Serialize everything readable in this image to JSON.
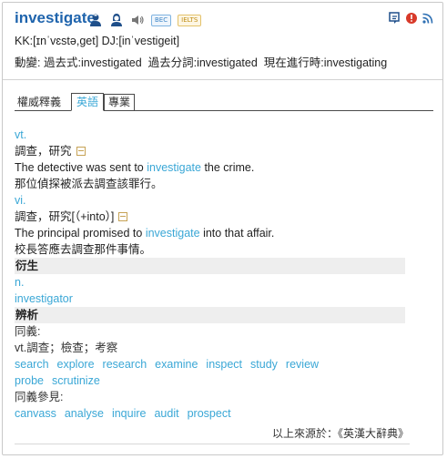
{
  "header": {
    "word": "investigate",
    "badges": {
      "bec": "BEC",
      "ielts": "IELTS"
    },
    "pronunciation": "KK:[ɪnˈvɛstə,get] DJ:[inˈvestigeit]",
    "forms": {
      "label": "動變:",
      "past": "過去式:investigated",
      "past_participle": "過去分詞:investigated",
      "present_participle": "現在進行時:investigating"
    },
    "icons": {
      "left": [
        "male-speaker-icon",
        "female-speaker-icon",
        "speaker-icon"
      ],
      "right": [
        "flashcard-icon",
        "report-error-icon",
        "rss-icon"
      ]
    }
  },
  "tabs": [
    "權威釋義",
    "英語",
    "專業"
  ],
  "selected_tab": "英語",
  "entries": [
    {
      "pos": "vt.",
      "definition": "調查，研究",
      "example_before": "The detective was sent to ",
      "example_word": "investigate",
      "example_after": " the crime.",
      "translation": "那位偵探被派去調查該罪行。"
    },
    {
      "pos": "vi.",
      "definition": "調查，研究[（+into）]",
      "example_before": "The principal promised to ",
      "example_word": "investigate",
      "example_after": " into that affair.",
      "translation": "校長答應去調查那件事情。"
    }
  ],
  "derivation": {
    "heading": "衍生",
    "pos": "n.",
    "word": "investigator"
  },
  "analysis": {
    "heading": "辨析",
    "synonyms_label": "同義:",
    "synonyms_def": "vt.調查；檢查；考察",
    "synonyms_row1": [
      "search",
      "explore",
      "research",
      "examine",
      "inspect",
      "study",
      "review"
    ],
    "synonyms_row2": [
      "probe",
      "scrutinize"
    ],
    "see_also_label": "同義參見:",
    "see_also": [
      "canvass",
      "analyse",
      "inquire",
      "audit",
      "prospect"
    ]
  },
  "source": "以上來源於：《英漢大辭典》",
  "colors": {
    "word": "#1f64ad",
    "link": "#3aa7d6",
    "border": "#c9c9c9"
  }
}
